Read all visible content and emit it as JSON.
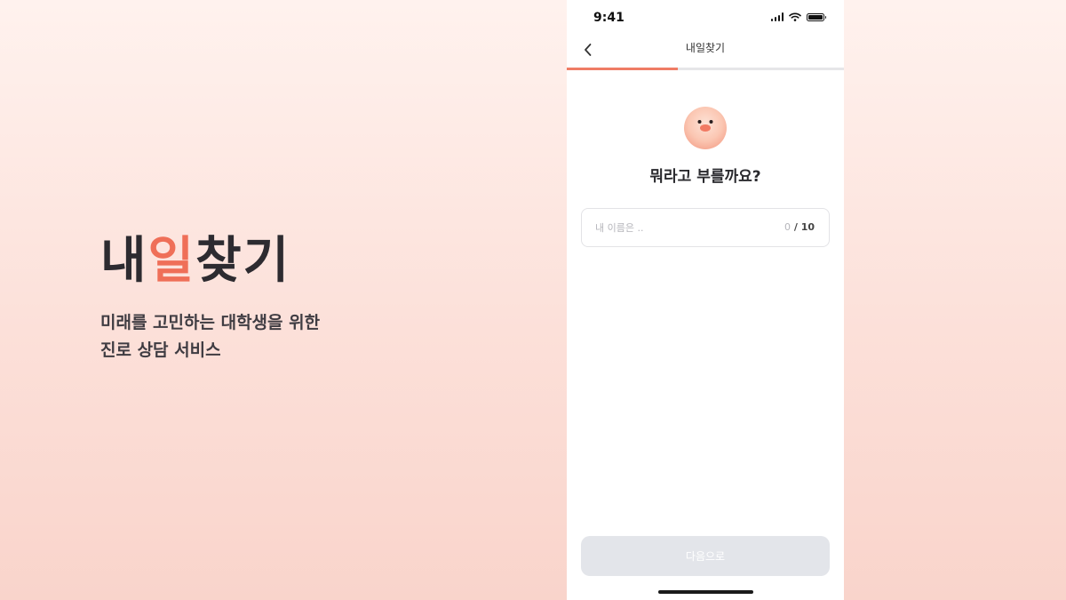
{
  "brand": {
    "title_part1": "내",
    "title_accent": "일",
    "title_part2": "찾기",
    "description_line1": "미래를 고민하는 대학생을 위한",
    "description_line2": "진로 상담 서비스"
  },
  "status_bar": {
    "time": "9:41",
    "icons": [
      "cellular-signal-icon",
      "wifi-icon",
      "battery-icon"
    ]
  },
  "nav": {
    "back_icon": "chevron-left-icon",
    "title": "내일찾기"
  },
  "progress": {
    "fraction": 0.4
  },
  "onboarding": {
    "mascot": "mascot-face-icon",
    "question": "뭐라고 부를까요?",
    "name_field": {
      "value": "",
      "placeholder": "내 이름은 ..",
      "current_count": "0",
      "separator": " / ",
      "max_count": "10"
    },
    "next_button_label": "다음으로",
    "next_button_enabled": false
  },
  "colors": {
    "accent": "#ef6f58",
    "progress": "#ef7c65",
    "disabled_button": "#e3e5ea",
    "background_top": "#fff2ee",
    "background_bottom": "#f9d4cb"
  }
}
